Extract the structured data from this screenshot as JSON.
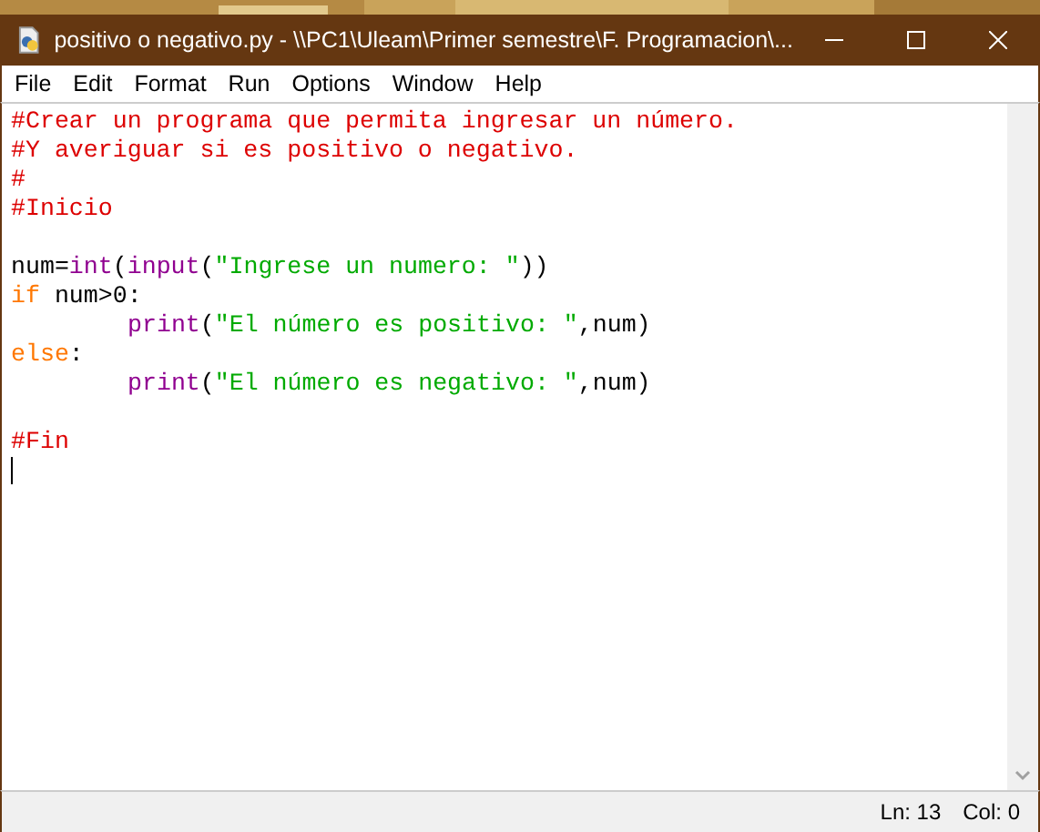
{
  "window": {
    "title": "positivo o negativo.py - \\\\PC1\\Uleam\\Primer semestre\\F. Programacion\\..."
  },
  "menu": [
    "File",
    "Edit",
    "Format",
    "Run",
    "Options",
    "Window",
    "Help"
  ],
  "editor": {
    "lines": [
      {
        "kind": "code",
        "indented": false,
        "tokens": [
          {
            "kind": "comment",
            "text": "#Crear un programa que permita ingresar un número."
          }
        ]
      },
      {
        "kind": "code",
        "indented": false,
        "tokens": [
          {
            "kind": "comment",
            "text": "#Y averiguar si es positivo o negativo."
          }
        ]
      },
      {
        "kind": "code",
        "indented": false,
        "tokens": [
          {
            "kind": "comment",
            "text": "#"
          }
        ]
      },
      {
        "kind": "code",
        "indented": false,
        "tokens": [
          {
            "kind": "comment",
            "text": "#Inicio"
          }
        ]
      },
      {
        "kind": "blank"
      },
      {
        "kind": "code",
        "indented": false,
        "tokens": [
          {
            "kind": "plain",
            "text": "num="
          },
          {
            "kind": "builtin",
            "text": "int"
          },
          {
            "kind": "plain",
            "text": "("
          },
          {
            "kind": "builtin",
            "text": "input"
          },
          {
            "kind": "plain",
            "text": "("
          },
          {
            "kind": "string",
            "text": "\"Ingrese un numero: \""
          },
          {
            "kind": "plain",
            "text": "))"
          }
        ]
      },
      {
        "kind": "code",
        "indented": false,
        "tokens": [
          {
            "kind": "keyword",
            "text": "if"
          },
          {
            "kind": "plain",
            "text": " num>0:"
          }
        ]
      },
      {
        "kind": "code",
        "indented": true,
        "tokens": [
          {
            "kind": "builtin",
            "text": "print"
          },
          {
            "kind": "plain",
            "text": "("
          },
          {
            "kind": "string",
            "text": "\"El número es positivo: \""
          },
          {
            "kind": "plain",
            "text": ",num)"
          }
        ]
      },
      {
        "kind": "code",
        "indented": false,
        "tokens": [
          {
            "kind": "keyword",
            "text": "else"
          },
          {
            "kind": "plain",
            "text": ":"
          }
        ]
      },
      {
        "kind": "code",
        "indented": true,
        "tokens": [
          {
            "kind": "builtin",
            "text": "print"
          },
          {
            "kind": "plain",
            "text": "("
          },
          {
            "kind": "string",
            "text": "\"El número es negativo: \""
          },
          {
            "kind": "plain",
            "text": ",num)"
          }
        ]
      },
      {
        "kind": "blank"
      },
      {
        "kind": "code",
        "indented": false,
        "tokens": [
          {
            "kind": "comment",
            "text": "#Fin"
          }
        ]
      },
      {
        "kind": "cursor"
      }
    ]
  },
  "status_bar": {
    "line": "Ln: 13",
    "column": "Col: 0"
  }
}
